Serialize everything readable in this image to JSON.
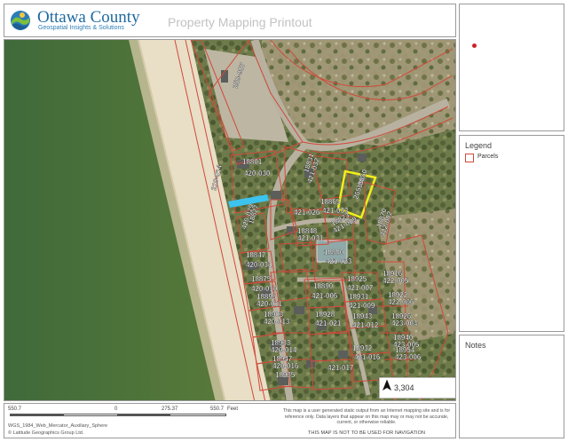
{
  "header": {
    "org_name": "Ottawa County",
    "org_tagline": "Geospatial Insights & Solutions",
    "print_title": "Property Mapping Printout"
  },
  "legend": {
    "title": "Legend",
    "items": [
      {
        "label": "Parcels",
        "color": "#d04a3a"
      }
    ]
  },
  "notes": {
    "title": "Notes"
  },
  "map": {
    "scale_ratio": "1: 3,304",
    "parcel_labels": [
      "250-007",
      "18801",
      "420-030",
      "210-014",
      "18831",
      "421-032",
      "18860",
      "265-007",
      "421-026",
      "18865",
      "421-033",
      "18873",
      "421-029",
      "18870",
      "422-002",
      "18827",
      "420-029",
      "18848",
      "421-031",
      "18880",
      "421-023",
      "18847",
      "420-031",
      "18875",
      "420-010",
      "18895",
      "420-011",
      "18890",
      "421-006",
      "18925",
      "421-007",
      "18916",
      "422-005",
      "18931",
      "421-009",
      "18922",
      "422-006",
      "18903",
      "420-013",
      "18928",
      "421-021",
      "18943",
      "421-012",
      "18926",
      "423-004",
      "18933",
      "420-014",
      "18940",
      "423-005",
      "18947",
      "420-016",
      "18932",
      "421-016",
      "18954",
      "423-006",
      "18935",
      "421-017"
    ]
  },
  "footer": {
    "scale_ticks": [
      "550.7",
      "0",
      "275.37",
      "550.7",
      "Feet"
    ],
    "projection": "WGS_1984_Web_Mercator_Auxiliary_Sphere",
    "copyright": "© Latitude Geographics Group Ltd.",
    "disclaimer": "This map is a user generated static output from an Internet mapping site and is for reference only. Data layers that appear on this map may or may not be accurate, current, or otherwise reliable.",
    "nav_warning": "THIS MAP IS NOT TO BE USED FOR NAVIGATION"
  },
  "colors": {
    "parcel_line": "#d04a3a",
    "selected_parcel": "#f2ee1a",
    "highlight_path": "#3cc3ee",
    "water": "#4e6a2a",
    "beach": "#e8dcc4",
    "brand": "#1f6aa0"
  }
}
